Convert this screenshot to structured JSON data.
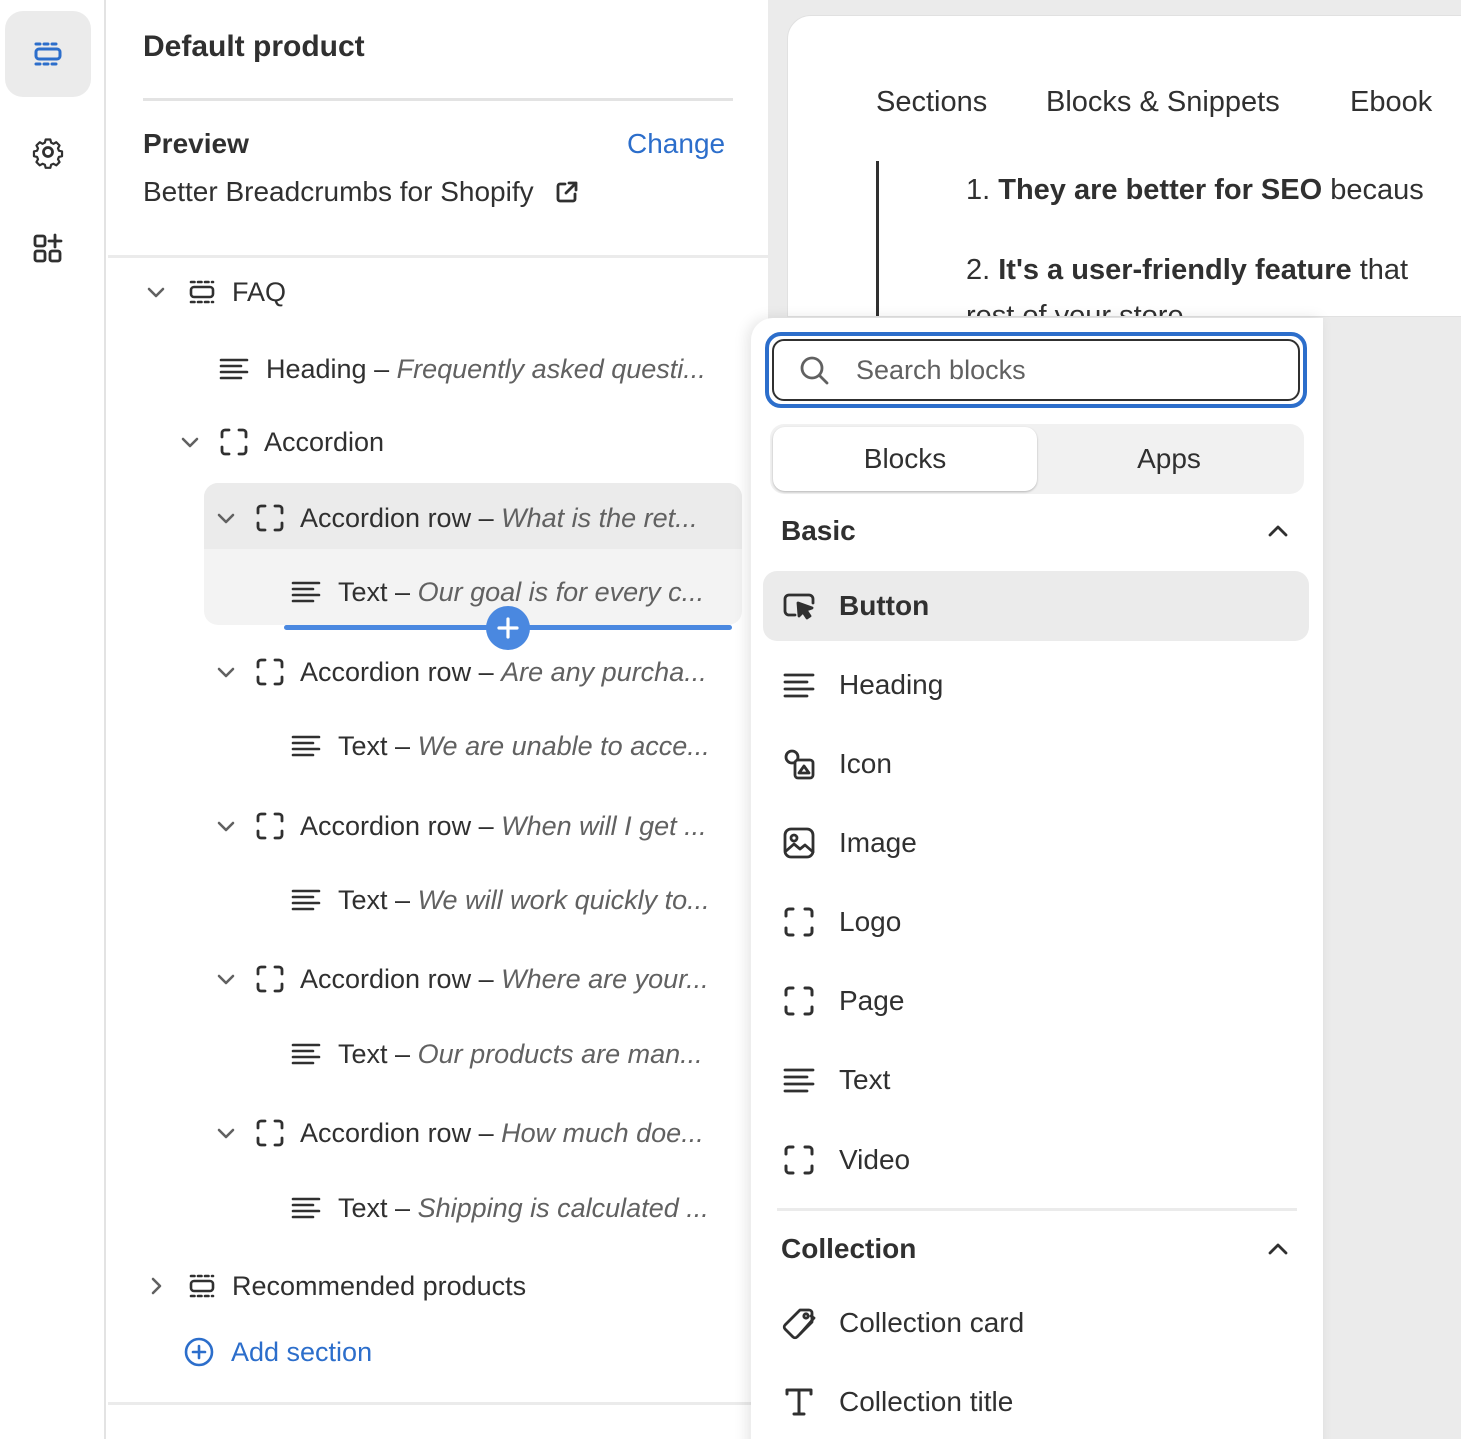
{
  "rail": {
    "items": [
      {
        "icon": "sections-icon",
        "active": true
      },
      {
        "icon": "gear-icon",
        "active": false
      },
      {
        "icon": "apps-icon",
        "active": false
      }
    ]
  },
  "sidebar": {
    "title": "Default product",
    "preview_label": "Preview",
    "change_label": "Change",
    "store_name": "Better Breadcrumbs for Shopify",
    "tree": {
      "faq": "FAQ",
      "heading": {
        "label": "Heading",
        "sub": "Frequently asked questi..."
      },
      "accordion": "Accordion",
      "rows": [
        {
          "label": "Accordion row",
          "sub": "What is the ret...",
          "text": "Our goal is for every c..."
        },
        {
          "label": "Accordion row",
          "sub": "Are any purcha...",
          "text": "We are unable to acce..."
        },
        {
          "label": "Accordion row",
          "sub": "When will I get ...",
          "text": "We will work quickly to..."
        },
        {
          "label": "Accordion row",
          "sub": "Where are your...",
          "text": "Our products are man..."
        },
        {
          "label": "Accordion row",
          "sub": "How much doe...",
          "text": "Shipping is calculated ..."
        }
      ],
      "text_label": "Text",
      "recommended": "Recommended products",
      "add_section": "Add section"
    }
  },
  "preview": {
    "nav": [
      "Sections",
      "Blocks & Snippets",
      "Ebook"
    ],
    "list": [
      {
        "num": "1.",
        "bold": "They are better for SEO",
        "rest": " becaus"
      },
      {
        "num": "2.",
        "bold": "It's a user-friendly feature",
        "rest": " that"
      }
    ],
    "cut_line": "rest of your store"
  },
  "picker": {
    "search_placeholder": "Search blocks",
    "tabs": [
      "Blocks",
      "Apps"
    ],
    "active_tab": "Blocks",
    "groups": [
      {
        "title": "Basic",
        "expanded": true,
        "items": [
          {
            "label": "Button",
            "icon": "button-cursor-icon",
            "hover": true
          },
          {
            "label": "Heading",
            "icon": "text-lines-icon"
          },
          {
            "label": "Icon",
            "icon": "shapes-icon"
          },
          {
            "label": "Image",
            "icon": "image-icon"
          },
          {
            "label": "Logo",
            "icon": "dashed-square-icon"
          },
          {
            "label": "Page",
            "icon": "dashed-square-icon"
          },
          {
            "label": "Text",
            "icon": "text-lines-icon"
          },
          {
            "label": "Video",
            "icon": "dashed-square-icon"
          }
        ]
      },
      {
        "title": "Collection",
        "expanded": true,
        "items": [
          {
            "label": "Collection card",
            "icon": "tag-icon"
          },
          {
            "label": "Collection title",
            "icon": "text-t-icon"
          }
        ]
      }
    ]
  },
  "colors": {
    "accent": "#2c6ecb",
    "drop_indicator": "#4a88e0",
    "text": "#303030",
    "muted": "#616161",
    "hover_bg": "#ebebeb"
  }
}
